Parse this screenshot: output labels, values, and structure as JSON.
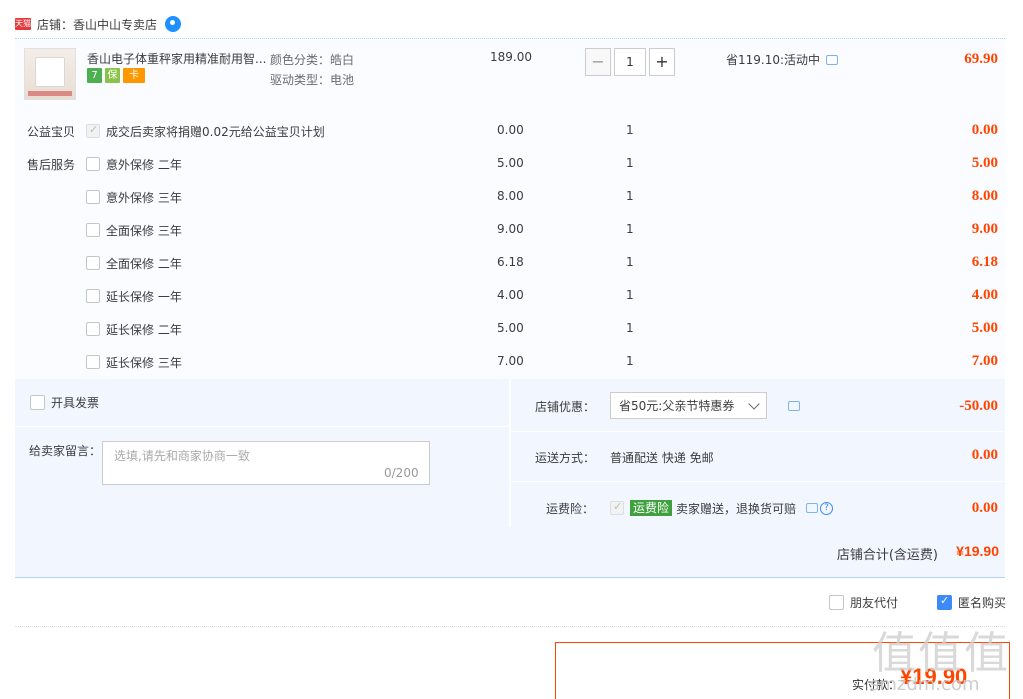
{
  "shop": {
    "badge": "天猫",
    "name": "店铺：香山中山专卖店"
  },
  "item": {
    "title": "香山电子体重秤家用精准耐用智...",
    "badges": [
      {
        "text": "7",
        "color": "#4caf50"
      },
      {
        "text": "保",
        "color": "#8bc34a"
      },
      {
        "text": "卡",
        "color": "#ff9800"
      }
    ],
    "sku_color": "颜色分类：皓白",
    "sku_drive": "驱动类型：电池",
    "price": "189.00",
    "qty": "1",
    "minus": "−",
    "plus": "+",
    "promo": "省119.10:活动中",
    "subtotal": "69.90"
  },
  "charity": {
    "label": "公益宝贝",
    "text": "成交后卖家将捐赠0.02元给公益宝贝计划",
    "price": "0.00",
    "qty": "1",
    "subtotal": "0.00"
  },
  "services": {
    "label": "售后服务",
    "items": [
      {
        "name": "意外保修 二年",
        "price": "5.00",
        "qty": "1",
        "subtotal": "5.00"
      },
      {
        "name": "意外保修 三年",
        "price": "8.00",
        "qty": "1",
        "subtotal": "8.00"
      },
      {
        "name": "全面保修 三年",
        "price": "9.00",
        "qty": "1",
        "subtotal": "9.00"
      },
      {
        "name": "全面保修 二年",
        "price": "6.18",
        "qty": "1",
        "subtotal": "6.18"
      },
      {
        "name": "延长保修 一年",
        "price": "4.00",
        "qty": "1",
        "subtotal": "4.00"
      },
      {
        "name": "延长保修 二年",
        "price": "5.00",
        "qty": "1",
        "subtotal": "5.00"
      },
      {
        "name": "延长保修 三年",
        "price": "7.00",
        "qty": "1",
        "subtotal": "7.00"
      }
    ]
  },
  "invoice": {
    "label": "开具发票"
  },
  "message": {
    "label": "给卖家留言：",
    "placeholder": "选填,请先和商家协商一致",
    "count": "0/200"
  },
  "coupon": {
    "label": "店铺优惠：",
    "selected": "省50元:父亲节特惠券",
    "amount": "-50.00"
  },
  "shipping": {
    "label": "运送方式：",
    "value": "普通配送 快递 免邮",
    "amount": "0.00"
  },
  "insurance": {
    "label": "运费险：",
    "tag": "运费险",
    "text": "卖家赠送，退换货可赔",
    "help": "?",
    "amount": "0.00"
  },
  "total": {
    "label": "店铺合计(含运费)",
    "value": "¥19.90"
  },
  "options": {
    "friend_pay": "朋友代付",
    "anonymous": "匿名购买"
  },
  "pay": {
    "label": "实付款：",
    "value": "¥19.90"
  },
  "watermark": {
    "main": "值值值",
    "sub": "smzdm.com"
  },
  "colors": {
    "accent": "#ff4400",
    "border": "#b2d1ff",
    "panel": "#f2f7ff",
    "check": "#3d8af7"
  }
}
